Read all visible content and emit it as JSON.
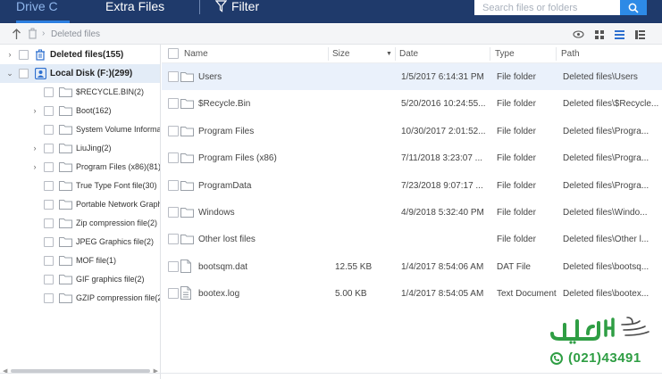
{
  "tabs": {
    "drive": "Drive C",
    "extra": "Extra Files",
    "filter": "Filter"
  },
  "search": {
    "placeholder": "Search files or folders"
  },
  "breadcrumb": {
    "current": "Deleted files"
  },
  "tree": [
    {
      "label": "Deleted files(155)",
      "level": 0,
      "chevron": "›",
      "icon": "trash-icon",
      "bold": true,
      "selected": false
    },
    {
      "label": "Local Disk (F:)(299)",
      "level": 0,
      "chevron": "⌄",
      "icon": "user-drive-icon",
      "bold": true,
      "selected": true
    },
    {
      "label": "$RECYCLE.BIN(2)",
      "level": 1,
      "chevron": "",
      "icon": "folder-icon"
    },
    {
      "label": "Boot(162)",
      "level": 1,
      "chevron": "›",
      "icon": "folder-icon"
    },
    {
      "label": "System Volume Informa",
      "level": 1,
      "chevron": "",
      "icon": "folder-icon"
    },
    {
      "label": "LiuJing(2)",
      "level": 1,
      "chevron": "›",
      "icon": "folder-icon"
    },
    {
      "label": "Program Files (x86)(81)",
      "level": 1,
      "chevron": "›",
      "icon": "folder-icon"
    },
    {
      "label": "True Type Font file(30)",
      "level": 1,
      "chevron": "",
      "icon": "folder-icon"
    },
    {
      "label": "Portable Network Graph",
      "level": 1,
      "chevron": "",
      "icon": "folder-icon"
    },
    {
      "label": "Zip compression file(2)",
      "level": 1,
      "chevron": "",
      "icon": "folder-icon"
    },
    {
      "label": "JPEG Graphics file(2)",
      "level": 1,
      "chevron": "",
      "icon": "folder-icon"
    },
    {
      "label": "MOF file(1)",
      "level": 1,
      "chevron": "",
      "icon": "folder-icon"
    },
    {
      "label": "GIF graphics file(2)",
      "level": 1,
      "chevron": "",
      "icon": "folder-icon"
    },
    {
      "label": "GZIP compression file(2)",
      "level": 1,
      "chevron": "",
      "icon": "folder-icon"
    }
  ],
  "columns": {
    "name": "Name",
    "size": "Size",
    "date": "Date",
    "type": "Type",
    "path": "Path"
  },
  "files": [
    {
      "name": "Users",
      "size": "",
      "date": "1/5/2017 6:14:31 PM",
      "type": "File folder",
      "path": "Deleted files\\Users",
      "icon": "folder-icon",
      "highlight": true
    },
    {
      "name": "$Recycle.Bin",
      "size": "",
      "date": "5/20/2016 10:24:55...",
      "type": "File folder",
      "path": "Deleted files\\$Recycle...",
      "icon": "folder-icon"
    },
    {
      "name": "Program Files",
      "size": "",
      "date": "10/30/2017 2:01:52...",
      "type": "File folder",
      "path": "Deleted files\\Progra...",
      "icon": "folder-icon"
    },
    {
      "name": "Program Files (x86)",
      "size": "",
      "date": "7/11/2018 3:23:07 ...",
      "type": "File folder",
      "path": "Deleted files\\Progra...",
      "icon": "folder-icon"
    },
    {
      "name": "ProgramData",
      "size": "",
      "date": "7/23/2018 9:07:17 ...",
      "type": "File folder",
      "path": "Deleted files\\Progra...",
      "icon": "folder-icon"
    },
    {
      "name": "Windows",
      "size": "",
      "date": "4/9/2018 5:32:40 PM",
      "type": "File folder",
      "path": "Deleted files\\Windo...",
      "icon": "folder-icon"
    },
    {
      "name": "Other lost files",
      "size": "",
      "date": "",
      "type": "File folder",
      "path": "Deleted files\\Other l...",
      "icon": "folder-icon"
    },
    {
      "name": "bootsqm.dat",
      "size": "12.55 KB",
      "date": "1/4/2017 8:54:06 AM",
      "type": "DAT File",
      "path": "Deleted files\\bootsq...",
      "icon": "file-icon"
    },
    {
      "name": "bootex.log",
      "size": "5.00 KB",
      "date": "1/4/2017 8:54:05 AM",
      "type": "Text Document",
      "path": "Deleted files\\bootex...",
      "icon": "text-file-icon"
    }
  ],
  "watermark": {
    "phone": "(021)43491"
  },
  "colors": {
    "topbar": "#1f3a6b",
    "accent": "#2d8ae6",
    "selected": "#e3ecf7",
    "watermark_green": "#2f9e44"
  }
}
